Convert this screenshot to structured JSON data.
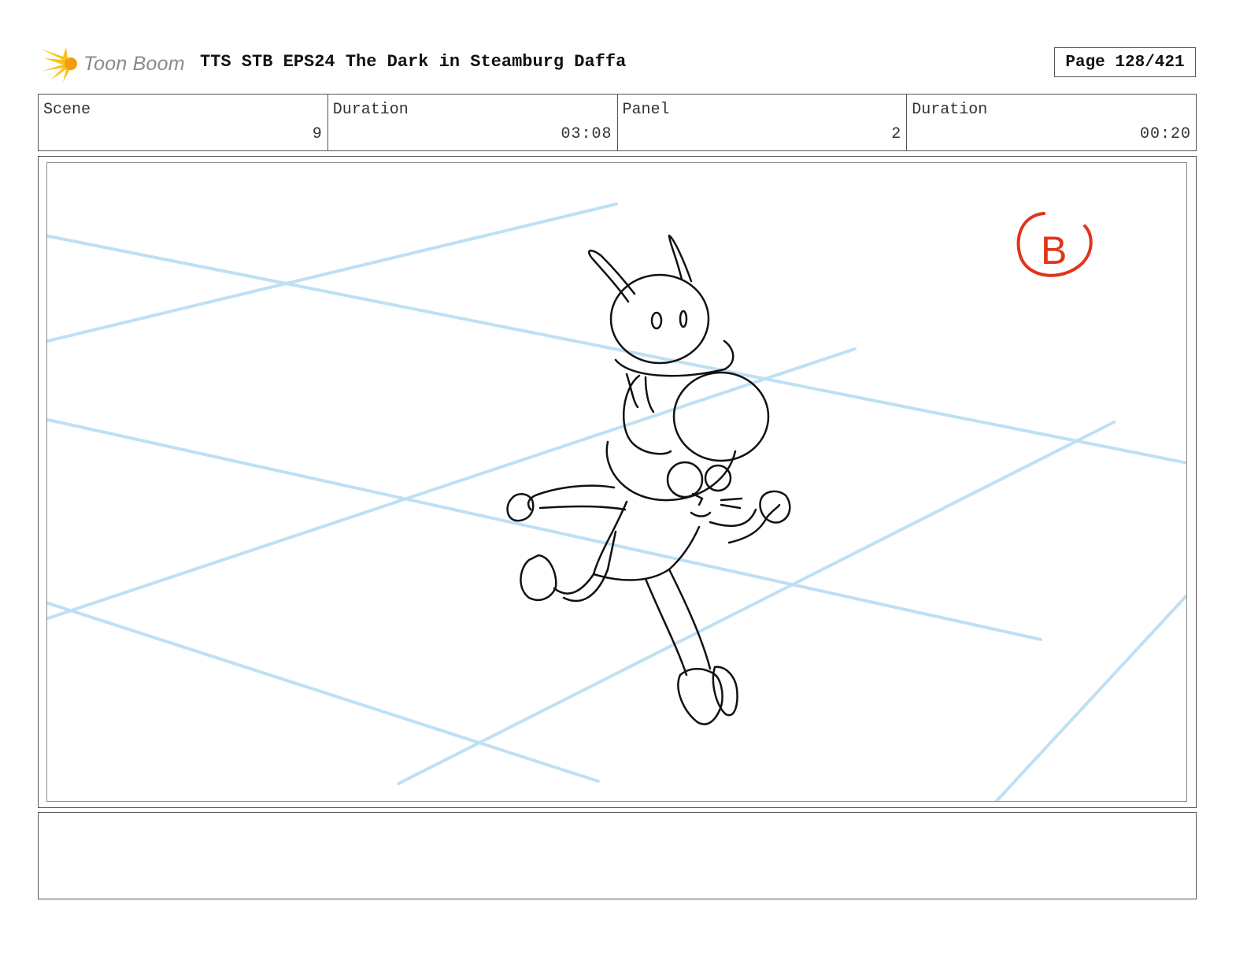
{
  "header": {
    "logo_text": "Toon Boom",
    "title": "TTS STB EPS24 The Dark in Steamburg Daffa",
    "page": "Page 128/421"
  },
  "info": {
    "scene_label": "Scene",
    "scene_value": "9",
    "scene_duration_label": "Duration",
    "scene_duration_value": "03:08",
    "panel_label": "Panel",
    "panel_value": "2",
    "panel_duration_label": "Duration",
    "panel_duration_value": "00:20"
  },
  "panel": {
    "sketch_subject": "character running with creature on head",
    "marker_letter": "B",
    "guide_color": "#bfe0f4",
    "marker_color": "#e0341b",
    "line_color": "#111111"
  },
  "notes": {
    "text": ""
  }
}
